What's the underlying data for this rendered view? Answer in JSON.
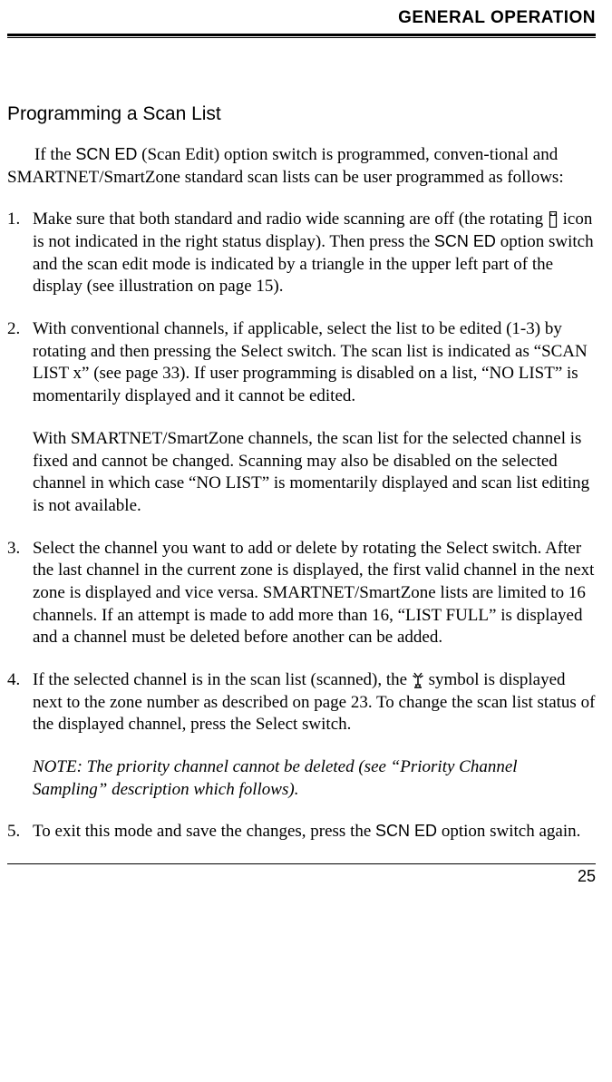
{
  "header": {
    "title": "GENERAL OPERATION"
  },
  "section": {
    "title": "Programming a Scan List"
  },
  "intro": {
    "p1a": "If the ",
    "scn_ed_1": "SCN ED",
    "p1b": " (Scan Edit) option switch is programmed, conven-tional and SMARTNET/SmartZone standard scan lists can be user programmed as follows:"
  },
  "steps": {
    "s1a": "Make sure that both standard and radio wide scanning are off (the rotating ",
    "s1b": " icon is not indicated in the right status display). Then press the ",
    "scn_ed_2": "SCN ED",
    "s1c": " option switch and the scan edit mode is indicated by a triangle in the upper left part of the display (see illustration on page 15).",
    "s2a": "With conventional channels, if applicable, select the list to be edited (1-3) by rotating and then pressing the Select switch. The scan list is indicated as “SCAN LIST x” (see page 33). If user programming is disabled on a list, “NO LIST” is momentarily displayed and it cannot be edited.",
    "s2b": "With SMARTNET/SmartZone channels, the scan list for the selected channel is fixed and cannot be changed. Scanning may also be disabled on the selected channel in which case “NO LIST” is momentarily displayed and scan list editing is not available.",
    "s3": "Select the channel you want to add or delete by rotating the Select switch. After the last channel in the current zone is displayed, the first valid channel in the next zone is displayed and vice versa. SMARTNET/SmartZone lists are limited to 16 channels. If an attempt is made to add more than 16, “LIST FULL” is displayed and a channel must be deleted before another can be added.",
    "s4a": "If the selected channel is in the scan list (scanned), the ",
    "s4b": " symbol is displayed next to the zone number as described on page 23. To change the scan list status of the displayed channel, press the Select switch.",
    "s4note": "NOTE: The priority channel cannot be deleted (see “Priority Channel Sampling” description which follows).",
    "s5a": "To exit this mode and save the changes, press the ",
    "scn_ed_3": "SCN ED",
    "s5b": " option switch again."
  },
  "page_number": "25"
}
